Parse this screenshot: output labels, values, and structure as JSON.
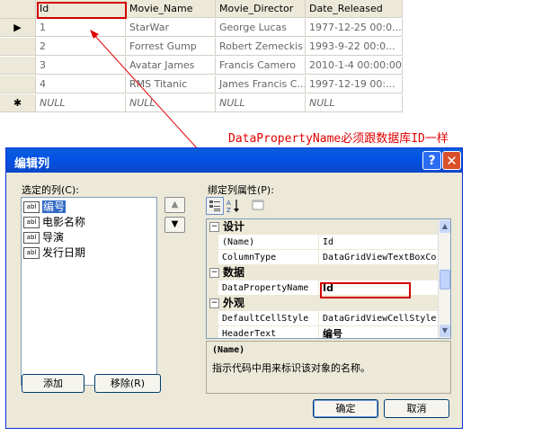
{
  "grid": {
    "headers": [
      "Id",
      "Movie_Name",
      "Movie_Director",
      "Date_Released"
    ],
    "rows": [
      {
        "marker": "▶",
        "cells": [
          "1",
          "StarWar",
          "George Lucas",
          "1977-12-25 00:0..."
        ]
      },
      {
        "marker": "",
        "cells": [
          "2",
          "Forrest Gump",
          "Robert Zemeckis",
          "1993-9-22 00:0..."
        ]
      },
      {
        "marker": "",
        "cells": [
          "3",
          "Avatar James",
          "Francis Camero",
          "2010-1-4 00:00:00"
        ]
      },
      {
        "marker": "",
        "cells": [
          "4",
          "RMS Titanic",
          "James Francis C...",
          "1997-12-19 00:..."
        ]
      },
      {
        "marker": "✱",
        "cells": [
          "NULL",
          "NULL",
          "NULL",
          "NULL"
        ]
      }
    ]
  },
  "annotation": "DataPropertyName必须跟数据库ID一样",
  "dialog": {
    "title": "编辑列",
    "help_glyph": "?",
    "close_glyph": "✕",
    "selected_columns_label": "选定的列(C):",
    "columns": [
      {
        "icon": "abl",
        "label": "编号",
        "selected": true
      },
      {
        "icon": "abl",
        "label": "电影名称",
        "selected": false
      },
      {
        "icon": "abl",
        "label": "导演",
        "selected": false
      },
      {
        "icon": "abl",
        "label": "发行日期",
        "selected": false
      }
    ],
    "move_up": "▲",
    "move_down": "▼",
    "properties_label": "绑定列属性(P):",
    "property_groups": [
      {
        "category": "设计",
        "props": [
          [
            "(Name)",
            "Id"
          ],
          [
            "ColumnType",
            "DataGridViewTextBoxCo"
          ]
        ]
      },
      {
        "category": "数据",
        "props": [
          [
            "DataPropertyName",
            "Id"
          ]
        ]
      },
      {
        "category": "外观",
        "props": [
          [
            "DefaultCellStyle",
            "DataGridViewCellStyle"
          ],
          [
            "HeaderText",
            "编号"
          ]
        ]
      }
    ],
    "description_title": "(Name)",
    "description_text": "指示代码中用来标识该对象的名称。",
    "add_button": "添加",
    "remove_button": "移除(R)",
    "ok_button": "确定",
    "cancel_button": "取消"
  }
}
